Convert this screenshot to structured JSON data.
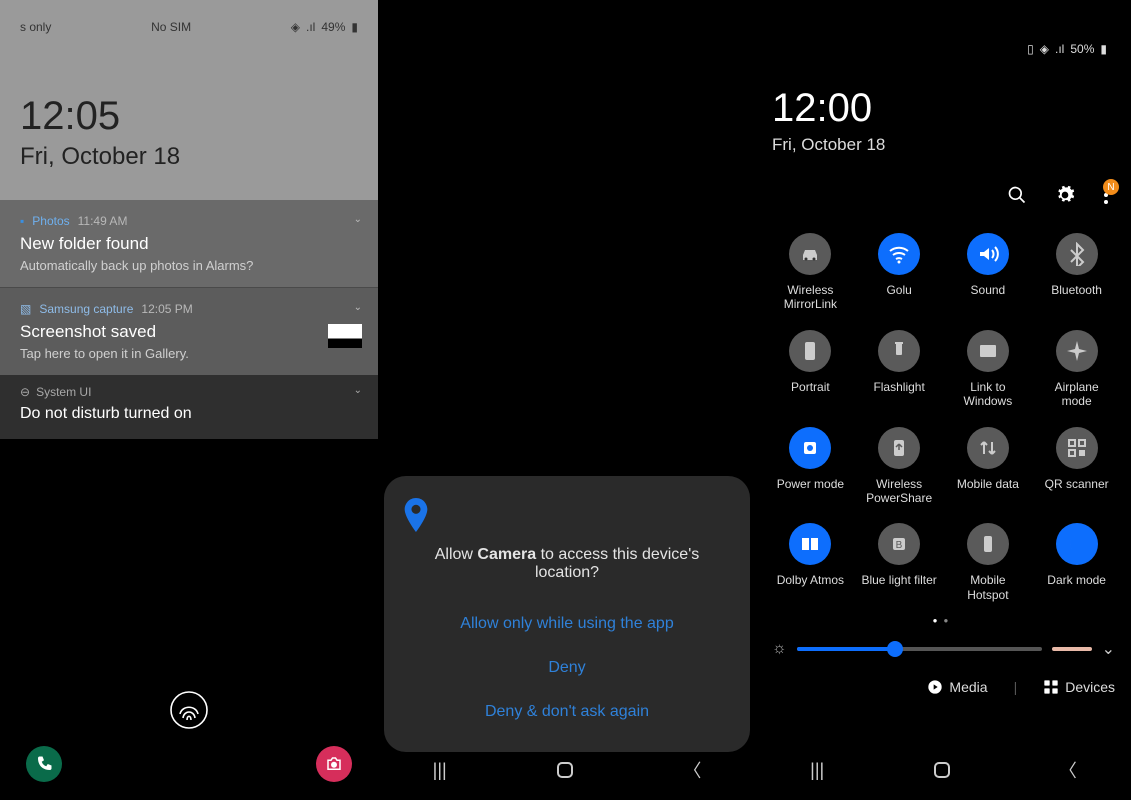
{
  "panel1": {
    "status_left": "s only",
    "status_sim": "No SIM",
    "battery": "49%",
    "time": "12:05",
    "date": "Fri, October 18",
    "notif1": {
      "app": "Photos",
      "time": "11:49 AM",
      "title": "New folder found",
      "body": "Automatically back up photos in Alarms?"
    },
    "notif2": {
      "app": "Samsung capture",
      "time": "12:05 PM",
      "title": "Screenshot saved",
      "body": "Tap here to open it in Gallery."
    },
    "notif3": {
      "app": "System UI",
      "title": "Do not disturb turned on"
    }
  },
  "panel2": {
    "dialog": {
      "msg_pre": "Allow ",
      "msg_bold": "Camera",
      "msg_post": " to access this device's location?",
      "opt1": "Allow only while using the app",
      "opt2": "Deny",
      "opt3": "Deny & don't ask again"
    }
  },
  "panel3": {
    "battery": "50%",
    "time": "12:00",
    "date": "Fri, October 18",
    "menu_badge": "N",
    "tiles": [
      {
        "label": "Wireless MirrorLink",
        "on": false,
        "icon": "car"
      },
      {
        "label": "Golu",
        "on": true,
        "icon": "wifi"
      },
      {
        "label": "Sound",
        "on": true,
        "icon": "sound"
      },
      {
        "label": "Bluetooth",
        "on": false,
        "icon": "bt"
      },
      {
        "label": "Portrait",
        "on": false,
        "icon": "portrait"
      },
      {
        "label": "Flashlight",
        "on": false,
        "icon": "flash"
      },
      {
        "label": "Link to Windows",
        "on": false,
        "icon": "link"
      },
      {
        "label": "Airplane mode",
        "on": false,
        "icon": "plane"
      },
      {
        "label": "Power mode",
        "on": true,
        "icon": "power"
      },
      {
        "label": "Wireless PowerShare",
        "on": false,
        "icon": "share"
      },
      {
        "label": "Mobile data",
        "on": false,
        "icon": "data"
      },
      {
        "label": "QR scanner",
        "on": false,
        "icon": "qr"
      },
      {
        "label": "Dolby Atmos",
        "on": true,
        "icon": "dolby"
      },
      {
        "label": "Blue light filter",
        "on": false,
        "icon": "blue"
      },
      {
        "label": "Mobile Hotspot",
        "on": false,
        "icon": "hotspot"
      },
      {
        "label": "Dark mode",
        "on": true,
        "icon": "dark"
      }
    ],
    "brightness_pct": 40,
    "media_label": "Media",
    "devices_label": "Devices"
  }
}
